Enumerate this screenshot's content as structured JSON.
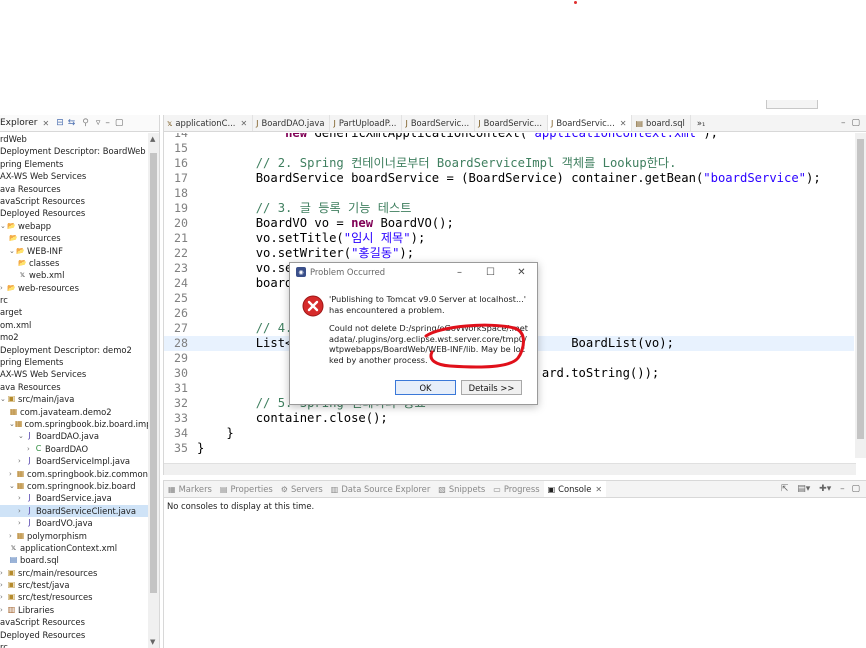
{
  "explorer": {
    "title": "Explorer",
    "items": [
      {
        "label": "rdWeb",
        "indent": 0,
        "icon": "",
        "twisty": ""
      },
      {
        "label": "Deployment Descriptor: BoardWeb",
        "indent": 0,
        "icon": "",
        "twisty": ""
      },
      {
        "label": "pring Elements",
        "indent": 0,
        "icon": "",
        "twisty": ""
      },
      {
        "label": "AX-WS Web Services",
        "indent": 0,
        "icon": "",
        "twisty": ""
      },
      {
        "label": "ava Resources",
        "indent": 0,
        "icon": "",
        "twisty": ""
      },
      {
        "label": "avaScript Resources",
        "indent": 0,
        "icon": "",
        "twisty": ""
      },
      {
        "label": "Deployed Resources",
        "indent": 0,
        "icon": "",
        "twisty": ""
      },
      {
        "label": "webapp",
        "indent": 0,
        "icon": "folder",
        "twisty": "v"
      },
      {
        "label": "resources",
        "indent": 1,
        "icon": "folder",
        "twisty": ""
      },
      {
        "label": "WEB-INF",
        "indent": 1,
        "icon": "folder",
        "twisty": "v"
      },
      {
        "label": "classes",
        "indent": 2,
        "icon": "folder",
        "twisty": ""
      },
      {
        "label": "web.xml",
        "indent": 2,
        "icon": "xml",
        "twisty": ""
      },
      {
        "label": "web-resources",
        "indent": 0,
        "icon": "folder",
        "twisty": ">"
      },
      {
        "label": "rc",
        "indent": 0,
        "icon": "",
        "twisty": ""
      },
      {
        "label": "arget",
        "indent": 0,
        "icon": "",
        "twisty": ""
      },
      {
        "label": "om.xml",
        "indent": 0,
        "icon": "",
        "twisty": ""
      },
      {
        "label": "mo2",
        "indent": 0,
        "icon": "",
        "twisty": ""
      },
      {
        "label": "Deployment Descriptor: demo2",
        "indent": 0,
        "icon": "",
        "twisty": ""
      },
      {
        "label": "pring Elements",
        "indent": 0,
        "icon": "",
        "twisty": ""
      },
      {
        "label": "AX-WS Web Services",
        "indent": 0,
        "icon": "",
        "twisty": ""
      },
      {
        "label": "ava Resources",
        "indent": 0,
        "icon": "",
        "twisty": ""
      },
      {
        "label": "src/main/java",
        "indent": 0,
        "icon": "srcfolder",
        "twisty": "v"
      },
      {
        "label": "com.javateam.demo2",
        "indent": 1,
        "icon": "package",
        "twisty": ""
      },
      {
        "label": "com.springbook.biz.board.impl",
        "indent": 1,
        "icon": "package",
        "twisty": "v"
      },
      {
        "label": "BoardDAO.java",
        "indent": 2,
        "icon": "java",
        "twisty": "v"
      },
      {
        "label": "BoardDAO",
        "indent": 3,
        "icon": "class",
        "twisty": ">"
      },
      {
        "label": "BoardServiceImpl.java",
        "indent": 2,
        "icon": "java",
        "twisty": ">"
      },
      {
        "label": "com.springbook.biz.common",
        "indent": 1,
        "icon": "package",
        "twisty": ">"
      },
      {
        "label": "com.springnook.biz.board",
        "indent": 1,
        "icon": "package",
        "twisty": "v"
      },
      {
        "label": "BoardService.java",
        "indent": 2,
        "icon": "java",
        "twisty": ">"
      },
      {
        "label": "BoardServiceClient.java",
        "indent": 2,
        "icon": "java",
        "twisty": ">",
        "selected": true
      },
      {
        "label": "BoardVO.java",
        "indent": 2,
        "icon": "java",
        "twisty": ">"
      },
      {
        "label": "polymorphism",
        "indent": 1,
        "icon": "package",
        "twisty": ">"
      },
      {
        "label": "applicationContext.xml",
        "indent": 1,
        "icon": "xml",
        "twisty": ""
      },
      {
        "label": "board.sql",
        "indent": 1,
        "icon": "sql",
        "twisty": ""
      },
      {
        "label": "src/main/resources",
        "indent": 0,
        "icon": "srcfolder",
        "twisty": ">"
      },
      {
        "label": "src/test/java",
        "indent": 0,
        "icon": "srcfolder",
        "twisty": ">"
      },
      {
        "label": "src/test/resources",
        "indent": 0,
        "icon": "srcfolder",
        "twisty": ">"
      },
      {
        "label": "Libraries",
        "indent": 0,
        "icon": "library",
        "twisty": ">"
      },
      {
        "label": "avaScript Resources",
        "indent": 0,
        "icon": "",
        "twisty": ""
      },
      {
        "label": "Deployed Resources",
        "indent": 0,
        "icon": "",
        "twisty": ""
      },
      {
        "label": "rc",
        "indent": 0,
        "icon": "",
        "twisty": ""
      }
    ]
  },
  "editor": {
    "tabs": [
      {
        "label": "applicationC...",
        "active": false,
        "closable": true
      },
      {
        "label": "BoardDAO.java",
        "active": false,
        "closable": false
      },
      {
        "label": "PartUploadP...",
        "active": false,
        "closable": false
      },
      {
        "label": "BoardServic...",
        "active": false,
        "closable": false
      },
      {
        "label": "BoardServic...",
        "active": false,
        "closable": false
      },
      {
        "label": "BoardServic...",
        "active": true,
        "closable": true
      },
      {
        "label": "board.sql",
        "active": false,
        "closable": false
      }
    ],
    "more_tabs": "»₁",
    "lines": [
      {
        "n": "14",
        "html": "            <span class=\"kw\">new</span> GenericXmlApplicationContext(<span class=\"str\">\"applicationContext.xml\"</span>);"
      },
      {
        "n": "15",
        "html": ""
      },
      {
        "n": "16",
        "html": "        <span class=\"cmt\">// 2. Spring 컨테이너로부터 BoardServiceImpl 객체를 Lookup한다.</span>"
      },
      {
        "n": "17",
        "html": "        BoardService boardService = (BoardService) container.getBean(<span class=\"str\">\"boardService\"</span>);"
      },
      {
        "n": "18",
        "html": ""
      },
      {
        "n": "19",
        "html": "        <span class=\"cmt\">// 3. 글 등록 기능 테스트</span>"
      },
      {
        "n": "20",
        "html": "        BoardVO vo = <span class=\"kw\">new</span> BoardVO();"
      },
      {
        "n": "21",
        "html": "        vo.setTitle(<span class=\"str\">\"임시 제목\"</span>);"
      },
      {
        "n": "22",
        "html": "        vo.setWriter(<span class=\"str\">\"홍길동\"</span>);"
      },
      {
        "n": "23",
        "html": "        vo.set"
      },
      {
        "n": "24",
        "html": "        boardS"
      },
      {
        "n": "25",
        "html": ""
      },
      {
        "n": "26",
        "html": ""
      },
      {
        "n": "27",
        "html": "        <span class=\"cmt\">// 4.</span>"
      },
      {
        "n": "28",
        "html": "        List&lt;B                                     BoardList(vo);",
        "current": true
      },
      {
        "n": "29",
        "html": ""
      },
      {
        "n": "30",
        "html": "                                               ard.toString());"
      },
      {
        "n": "31",
        "html": ""
      },
      {
        "n": "32",
        "html": "        <span class=\"cmt\">// 5. Spring 컨테이너 종료</span>"
      },
      {
        "n": "33",
        "html": "        container.close();"
      },
      {
        "n": "34",
        "html": "    }"
      },
      {
        "n": "35",
        "html": "}"
      },
      {
        "n": "36",
        "html": ""
      }
    ]
  },
  "bottom": {
    "tabs": [
      {
        "label": "Markers",
        "icon": "▦",
        "active": false
      },
      {
        "label": "Properties",
        "icon": "▤",
        "active": false
      },
      {
        "label": "Servers",
        "icon": "⚙",
        "active": false
      },
      {
        "label": "Data Source Explorer",
        "icon": "▥",
        "active": false
      },
      {
        "label": "Snippets",
        "icon": "▧",
        "active": false
      },
      {
        "label": "Progress",
        "icon": "▭",
        "active": false
      },
      {
        "label": "Console",
        "icon": "▣",
        "active": true
      }
    ],
    "console_message": "No consoles to display at this time."
  },
  "dialog": {
    "title": "Problem Occurred",
    "message": "'Publishing to Tomcat v9.0 Server at localhost...' has encountered a problem.",
    "detail": "Could not delete D:/spring/eGovWorkSpace/.metadata/.plugins/org.eclipse.wst.server.core/tmp0/wtpwebapps/BoardWeb/WEB-INF/lib. May be locked by another process.",
    "ok_label": "OK",
    "details_label": "Details >>"
  },
  "colors": {
    "keyword": "#7f0055",
    "string": "#2a00ff",
    "comment": "#3f7f5f",
    "annotation": "#e0101a",
    "selection": "#cfe3f7"
  }
}
